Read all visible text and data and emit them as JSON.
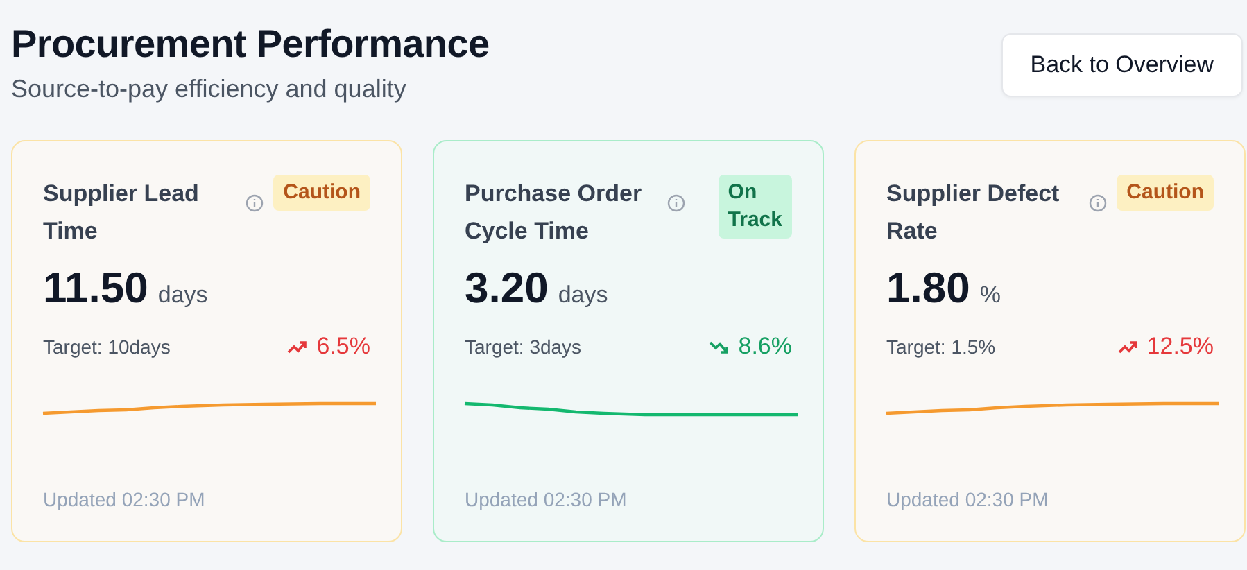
{
  "header": {
    "title": "Procurement Performance",
    "subtitle": "Source-to-pay efficiency and quality",
    "button": "Back to Overview"
  },
  "cards": [
    {
      "title": "Supplier Lead Time",
      "on_track": false,
      "badge": "Caution",
      "value": "11.50",
      "unit": "days",
      "target": "Target: 10days",
      "rising": true,
      "change": "6.5%",
      "updated": "Updated 02:30 PM"
    },
    {
      "title": "Purchase Order Cycle Time",
      "on_track": true,
      "badge": "On Track",
      "value": "3.20",
      "unit": "days",
      "target": "Target: 3days",
      "rising": false,
      "change": "8.6%",
      "updated": "Updated 02:30 PM"
    },
    {
      "title": "Supplier Defect Rate",
      "on_track": false,
      "badge": "Caution",
      "value": "1.80",
      "unit": "%",
      "target": "Target: 1.5%",
      "rising": true,
      "change": "12.5%",
      "updated": "Updated 02:30 PM"
    }
  ]
}
